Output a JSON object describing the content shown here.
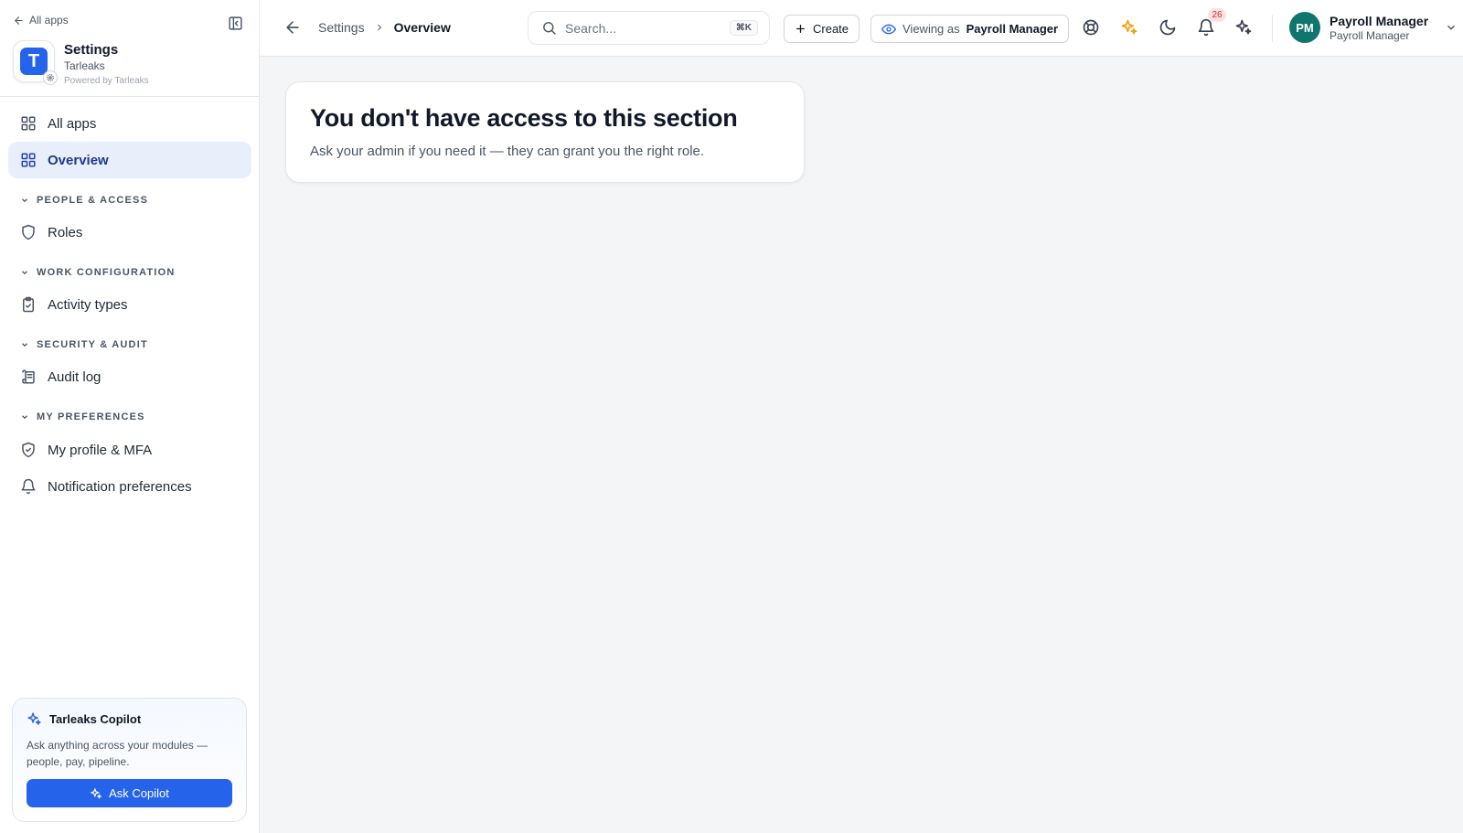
{
  "sidebar": {
    "back_label": "All apps",
    "brand": {
      "title": "Settings",
      "subtitle": "Tarleaks",
      "powered": "Powered by Tarleaks",
      "logo_letter": "T"
    },
    "nav_top": [
      {
        "label": "All apps",
        "icon": "grid-icon"
      },
      {
        "label": "Overview",
        "icon": "grid-icon",
        "active": true
      }
    ],
    "sections": [
      {
        "title": "PEOPLE & ACCESS",
        "items": [
          {
            "label": "Roles",
            "icon": "shield-icon"
          }
        ]
      },
      {
        "title": "WORK CONFIGURATION",
        "items": [
          {
            "label": "Activity types",
            "icon": "clipboard-check-icon"
          }
        ]
      },
      {
        "title": "SECURITY & AUDIT",
        "items": [
          {
            "label": "Audit log",
            "icon": "scroll-icon"
          }
        ]
      },
      {
        "title": "MY PREFERENCES",
        "items": [
          {
            "label": "My profile & MFA",
            "icon": "shield-check-icon"
          },
          {
            "label": "Notification preferences",
            "icon": "bell-icon"
          }
        ]
      }
    ],
    "copilot": {
      "title": "Tarleaks Copilot",
      "description": "Ask anything across your modules — people, pay, pipeline.",
      "button_label": "Ask Copilot"
    }
  },
  "topbar": {
    "breadcrumb": {
      "parent": "Settings",
      "current": "Overview"
    },
    "search": {
      "placeholder": "Search...",
      "shortcut": "⌘K"
    },
    "create_label": "Create",
    "viewing_as": {
      "label": "Viewing as",
      "role": "Payroll Manager"
    },
    "notification_count": "26",
    "user": {
      "initials": "PM",
      "name": "Payroll Manager",
      "role": "Payroll Manager"
    }
  },
  "main": {
    "title": "You don't have access to this section",
    "description": "Ask your admin if you need it — they can grant you the right role."
  },
  "colors": {
    "accent": "#2563eb",
    "active_bg": "#e8effb",
    "avatar": "#0f766e",
    "sparkle": "#f59e0b"
  }
}
